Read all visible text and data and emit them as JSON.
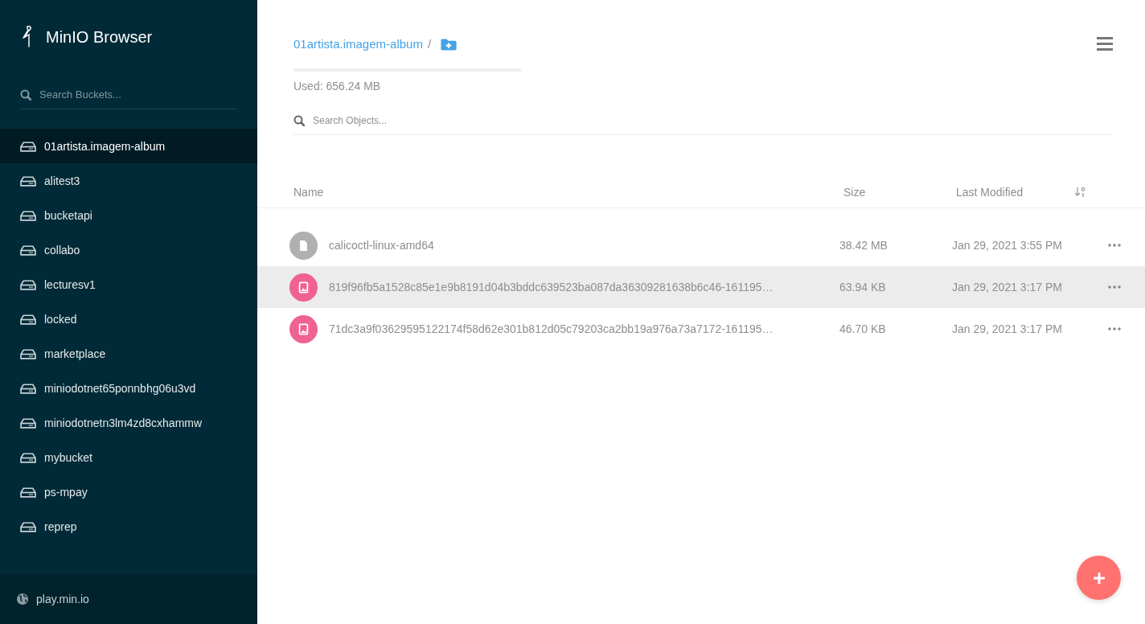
{
  "sidebar": {
    "logo_text": "MinIO Browser",
    "search": {
      "placeholder": "Search Buckets..."
    },
    "buckets": [
      {
        "name": "01artista.imagem-album",
        "selected": true
      },
      {
        "name": "alitest3",
        "selected": false
      },
      {
        "name": "bucketapi",
        "selected": false
      },
      {
        "name": "collabo",
        "selected": false
      },
      {
        "name": "lecturesv1",
        "selected": false
      },
      {
        "name": "locked",
        "selected": false
      },
      {
        "name": "marketplace",
        "selected": false
      },
      {
        "name": "miniodotnet65ponnbhg06u3vd",
        "selected": false
      },
      {
        "name": "miniodotnetn3lm4zd8cxhammw",
        "selected": false
      },
      {
        "name": "mybucket",
        "selected": false
      },
      {
        "name": "ps-mpay",
        "selected": false
      },
      {
        "name": "reprep",
        "selected": false
      }
    ],
    "host": "play.min.io"
  },
  "main": {
    "breadcrumb": "01artista.imagem-album",
    "separator": "/",
    "usage": {
      "level": 0,
      "label": "Used: 656.24 MB"
    },
    "search": {
      "placeholder": "Search Objects..."
    },
    "table": {
      "columns": [
        "Name",
        "Size",
        "Last Modified"
      ],
      "rows": [
        {
          "kind": "file",
          "name": "calicoctl-linux-amd64",
          "size": "38.42 MB",
          "modified": "Jan 29, 2021 3:55 PM",
          "highlighted": false
        },
        {
          "kind": "image",
          "name": "819f96fb5a1528c85e1e9b8191d04b3bddc639523ba087da36309281638b6c46-161195…",
          "size": "63.94 KB",
          "modified": "Jan 29, 2021 3:17 PM",
          "highlighted": true
        },
        {
          "kind": "image",
          "name": "71dc3a9f03629595122174f58d62e301b812d05c79203ca2bb19a976a73a7172-161195…",
          "size": "46.70 KB",
          "modified": "Jan 29, 2021 3:17 PM",
          "highlighted": false
        }
      ]
    }
  }
}
